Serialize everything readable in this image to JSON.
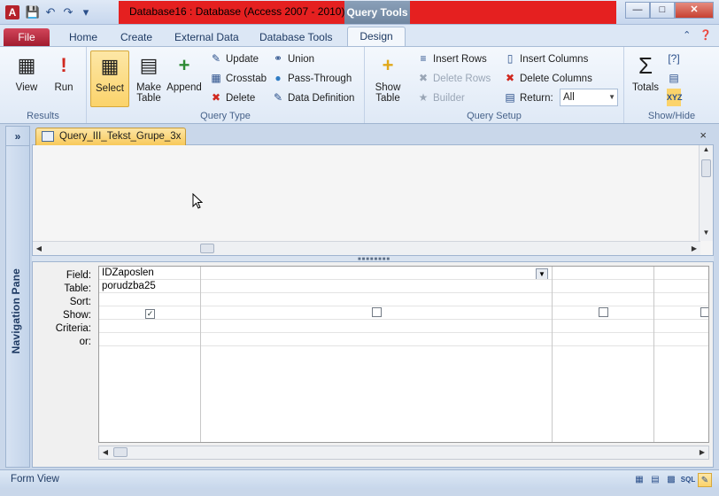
{
  "titlebar": {
    "title": "Database16 : Database (Access 2007 - 2010)",
    "context_tab": "Query Tools",
    "app_icon": "A",
    "icons": [
      "save-icon",
      "undo-icon",
      "redo-icon",
      "customize-qat-icon"
    ],
    "window_buttons": [
      "minimize-icon",
      "maximize-icon",
      "close-icon"
    ],
    "accent_color": "#e52020"
  },
  "ribbon_tabs": {
    "file": "File",
    "home": "Home",
    "create": "Create",
    "external_data": "External Data",
    "database_tools": "Database Tools",
    "design": "Design",
    "active": "Design"
  },
  "ribbon": {
    "results": {
      "label": "Results",
      "view": "View",
      "run": "Run"
    },
    "query_type": {
      "label": "Query Type",
      "select": "Select",
      "make_table": "Make Table",
      "append": "Append",
      "update": "Update",
      "crosstab": "Crosstab",
      "delete": "Delete",
      "union": "Union",
      "pass_through": "Pass-Through",
      "data_definition": "Data Definition",
      "active": "Select"
    },
    "query_setup": {
      "label": "Query Setup",
      "show_table": "Show Table",
      "insert_rows": "Insert Rows",
      "delete_rows": "Delete Rows",
      "builder": "Builder",
      "insert_columns": "Insert Columns",
      "delete_columns": "Delete Columns",
      "return_label": "Return:",
      "return_value": "All"
    },
    "show_hide": {
      "label": "Show/Hide",
      "totals": "Totals"
    }
  },
  "nav_pane": {
    "label": "Navigation Pane",
    "collapse": "»"
  },
  "document": {
    "tab_title": "Query_III_Tekst_Grupe_3x",
    "close": "×"
  },
  "design_grid": {
    "row_labels": [
      "Field:",
      "Table:",
      "Sort:",
      "Show:",
      "Criteria:",
      "or:"
    ],
    "columns": [
      {
        "field": "IDZaposlen",
        "table": "porudzba25",
        "sort": "",
        "show": true,
        "criteria": "",
        "or": ""
      },
      {
        "field": "",
        "table": "",
        "sort": "",
        "show": false,
        "criteria": "",
        "or": ""
      },
      {
        "field": "",
        "table": "",
        "sort": "",
        "show": false,
        "criteria": "",
        "or": ""
      },
      {
        "field": "",
        "table": "",
        "sort": "",
        "show": false,
        "criteria": "",
        "or": ""
      }
    ]
  },
  "statusbar": {
    "text": "Form View",
    "views": [
      "datasheet-view-icon",
      "pivottable-view-icon",
      "pivotchart-view-icon",
      "sql-view-icon",
      "design-view-icon"
    ],
    "sql": "SQL"
  }
}
